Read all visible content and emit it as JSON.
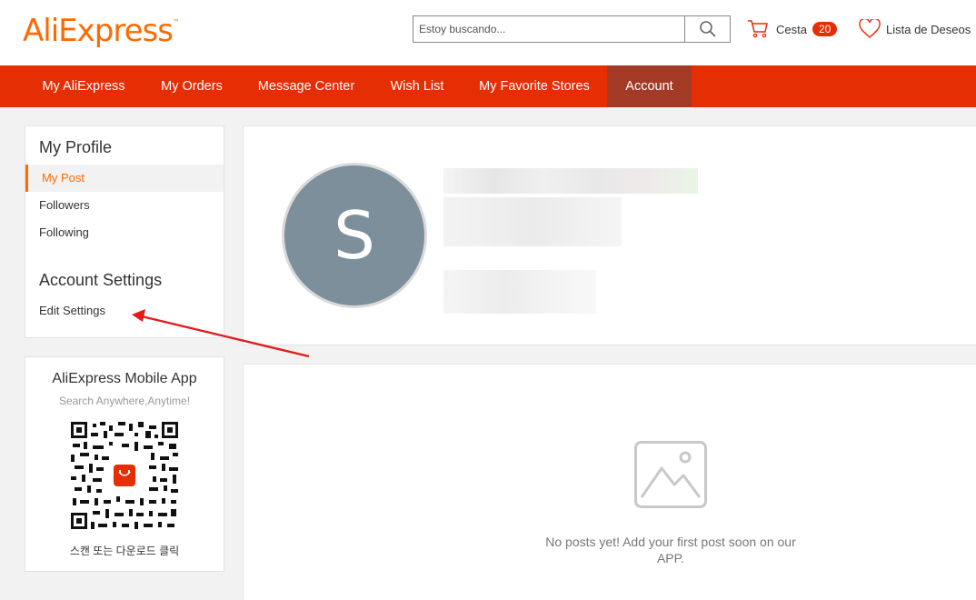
{
  "header": {
    "logo": "AliExpress",
    "logo_tm": "™",
    "search_placeholder": "Estoy buscando...",
    "cart_label": "Cesta",
    "cart_count": "20",
    "wishlist_label": "Lista de Deseos"
  },
  "nav": {
    "items": [
      {
        "label": "My AliExpress"
      },
      {
        "label": "My Orders"
      },
      {
        "label": "Message Center"
      },
      {
        "label": "Wish List"
      },
      {
        "label": "My Favorite Stores"
      },
      {
        "label": "Account",
        "active": true
      }
    ]
  },
  "sidebar": {
    "profile_title": "My Profile",
    "profile_links": [
      "My Post",
      "Followers",
      "Following"
    ],
    "settings_title": "Account Settings",
    "settings_link": "Edit Settings"
  },
  "app": {
    "title": "AliExpress Mobile App",
    "subtitle": "Search Anywhere,Anytime!",
    "scan_text": "스캔 또는 다운로드 클릭"
  },
  "profile": {
    "avatar_letter": "S"
  },
  "posts": {
    "empty_text": "No posts yet! Add your first post soon on our APP."
  },
  "colors": {
    "brand_orange": "#ff6a00",
    "nav_red": "#e62e04",
    "nav_active": "#a33a26",
    "avatar_bg": "#7c8f9b"
  }
}
